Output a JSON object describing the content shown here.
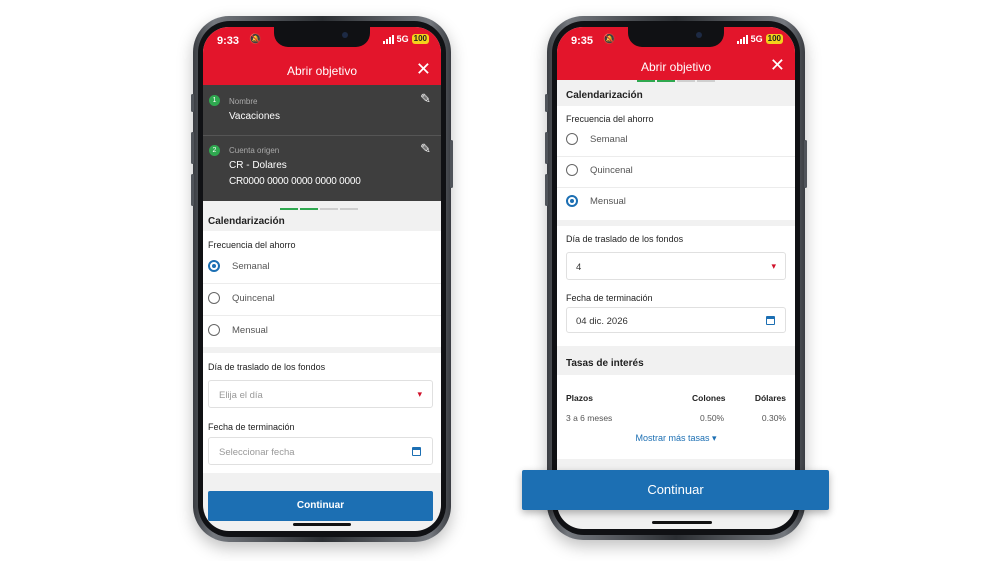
{
  "status": {
    "time_left": "9:33",
    "time_right": "9:35",
    "network": "5G",
    "battery": "100"
  },
  "header": {
    "title": "Abrir objetivo"
  },
  "summary": {
    "step1_number": "1",
    "step1_label": "Nombre",
    "step1_value": "Vacaciones",
    "step2_number": "2",
    "step2_label": "Cuenta origen",
    "step2_value": "CR - Dolares",
    "step2_account": "CR0000 0000 0000 0000 0000"
  },
  "calendar": {
    "section_title": "Calendarización",
    "frequency_label": "Frecuencia del ahorro",
    "options": [
      "Semanal",
      "Quincenal",
      "Mensual"
    ],
    "transfer_day_label": "Día de traslado de los fondos",
    "transfer_day_placeholder": "Elija el día",
    "transfer_day_value": "4",
    "end_date_label": "Fecha de terminación",
    "end_date_placeholder": "Seleccionar fecha",
    "end_date_value": "04 dic. 2026"
  },
  "rates": {
    "section_title": "Tasas de interés",
    "headers": [
      "Plazos",
      "Colones",
      "Dólares"
    ],
    "row": [
      "3 a 6 meses",
      "0.50%",
      "0.30%"
    ],
    "more_link": "Mostrar más tasas"
  },
  "continue_label": "Continuar",
  "colors": {
    "brand_red": "#e3152b",
    "action_blue": "#1c6fb3",
    "step_green": "#2fa84f"
  },
  "selected_frequency_left": "Semanal",
  "selected_frequency_right": "Mensual",
  "icons": [
    "bell-off-icon",
    "signal-icon",
    "battery-icon",
    "close-icon",
    "pencil-icon",
    "chevron-down-icon",
    "calendar-icon"
  ]
}
